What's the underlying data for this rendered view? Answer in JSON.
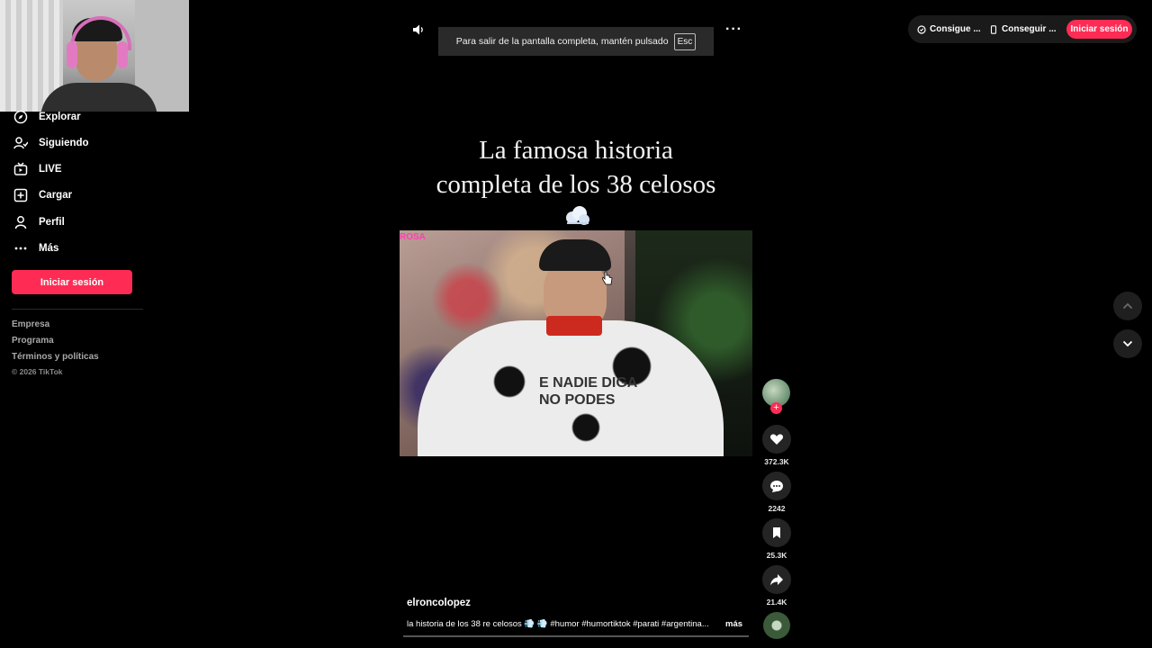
{
  "sidebar": {
    "items": [
      {
        "label": "Explorar",
        "icon": "compass-icon"
      },
      {
        "label": "Siguiendo",
        "icon": "user-follow-icon"
      },
      {
        "label": "LIVE",
        "icon": "tv-icon"
      },
      {
        "label": "Cargar",
        "icon": "upload-plus-icon"
      },
      {
        "label": "Perfil",
        "icon": "person-icon"
      },
      {
        "label": "Más",
        "icon": "dots-icon"
      }
    ],
    "login_label": "Iniciar sesión",
    "footer_links": [
      "Empresa",
      "Programa",
      "Términos y políticas"
    ],
    "copyright": "© 2026 TikTok"
  },
  "player": {
    "fullscreen_toast": "Para salir de la pantalla completa, mantén pulsado",
    "esc_key": "Esc",
    "more_label": "···",
    "title_line1": "La famosa historia",
    "title_line2": "completa de los 38 celosos",
    "frame_tag": "ROSA",
    "shirt_text": "E NADIE DIGA NO PODES",
    "author": "elroncolopez",
    "caption": "la historia de los 38 re celosos 💨 💨 #humor #humortiktok #parati #argentina...",
    "caption_more": "más"
  },
  "rail": {
    "follow_plus": "+",
    "likes": "372.3K",
    "comments": "2242",
    "saves": "25.3K",
    "shares": "21.4K"
  },
  "topbar": {
    "item1": "Consigue ...",
    "item2": "Conseguir ...",
    "login": "Iniciar sesión"
  },
  "colors": {
    "accent": "#fe2c55",
    "background": "#000000",
    "panel": "#1a1a1a"
  }
}
